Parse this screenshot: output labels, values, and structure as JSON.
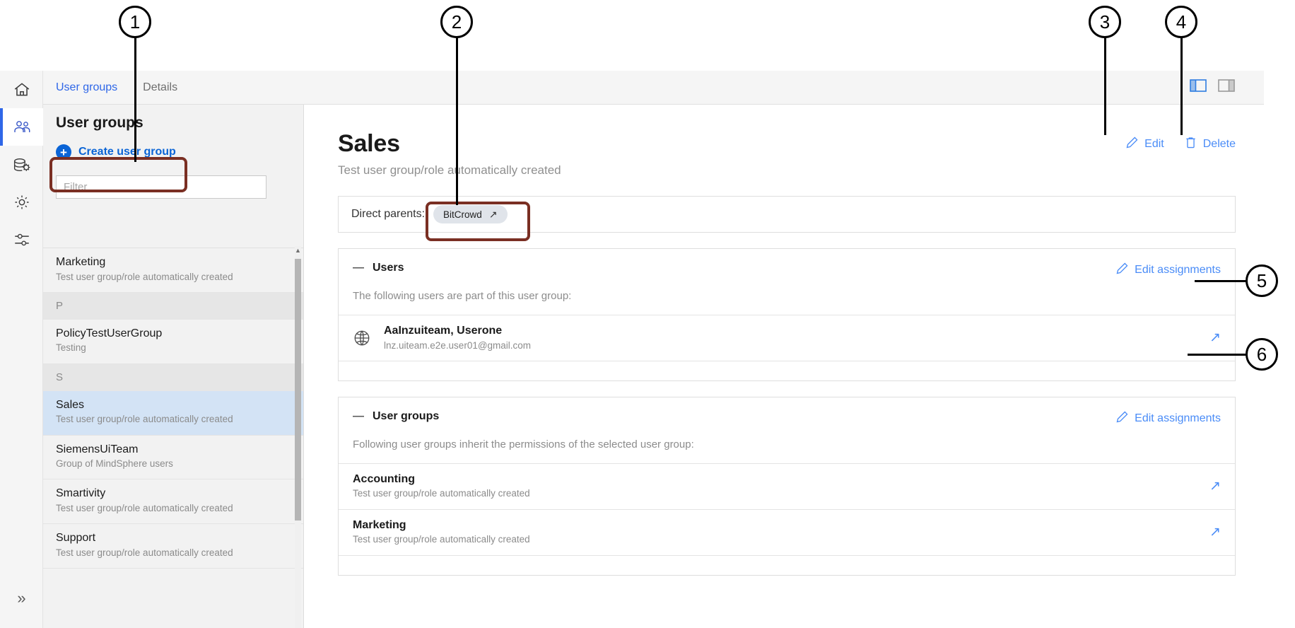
{
  "app": {
    "tabs": [
      {
        "label": "User groups",
        "active": true
      },
      {
        "label": "Details",
        "active": false
      }
    ],
    "panel_toggles": [
      {
        "name": "left-panel-toggle",
        "state": "active"
      },
      {
        "name": "right-panel-toggle",
        "state": "inactive"
      }
    ]
  },
  "rail": {
    "items": [
      {
        "icon": "home-icon",
        "name": "home",
        "active": false
      },
      {
        "icon": "users-icon",
        "name": "user-groups",
        "active": true
      },
      {
        "icon": "assets-icon",
        "name": "assets",
        "active": false
      },
      {
        "icon": "gear-icon",
        "name": "settings",
        "active": false
      },
      {
        "icon": "sliders-icon",
        "name": "preferences",
        "active": false
      }
    ],
    "expand_label": "»"
  },
  "sidebar": {
    "title": "User groups",
    "create_label": "Create user group",
    "create_icon": "plus-circle-icon",
    "filter_placeholder": "Filter",
    "filter_value": "",
    "list": [
      {
        "type": "item",
        "name": "Marketing",
        "desc": "Test user group/role automatically created",
        "selected": false
      },
      {
        "type": "header",
        "name": "P"
      },
      {
        "type": "item",
        "name": "PolicyTestUserGroup",
        "desc": "Testing",
        "selected": false
      },
      {
        "type": "header",
        "name": "S"
      },
      {
        "type": "item",
        "name": "Sales",
        "desc": "Test user group/role automatically created",
        "selected": true
      },
      {
        "type": "item",
        "name": "SiemensUiTeam",
        "desc": "Group of MindSphere users",
        "selected": false
      },
      {
        "type": "item",
        "name": "Smartivity",
        "desc": "Test user group/role automatically created",
        "selected": false
      },
      {
        "type": "item",
        "name": "Support",
        "desc": "Test user group/role automatically created",
        "selected": false
      }
    ]
  },
  "detail": {
    "title": "Sales",
    "subtitle": "Test user group/role automatically created",
    "edit_label": "Edit",
    "delete_label": "Delete",
    "parents_label": "Direct parents:",
    "parents_chips": [
      {
        "label": "BitCrowd",
        "arrow": "↗"
      }
    ],
    "users_section": {
      "title": "Users",
      "collapse": "—",
      "description": "The following users are part of this user group:",
      "edit_assignments_label": "Edit assignments",
      "rows": [
        {
          "icon": "globe-icon",
          "name": "AaInzuiteam, Userone",
          "sub": "lnz.uiteam.e2e.user01@gmail.com",
          "go": "↗"
        }
      ]
    },
    "usergroups_section": {
      "title": "User groups",
      "collapse": "—",
      "description": "Following user groups inherit the permissions of the selected user group:",
      "edit_assignments_label": "Edit assignments",
      "rows": [
        {
          "name": "Accounting",
          "sub": "Test user group/role automatically created",
          "go": "↗"
        },
        {
          "name": "Marketing",
          "sub": "Test user group/role automatically created",
          "go": "↗"
        }
      ]
    }
  },
  "callouts": [
    {
      "number": "1"
    },
    {
      "number": "2"
    },
    {
      "number": "3"
    },
    {
      "number": "4"
    },
    {
      "number": "5"
    },
    {
      "number": "6"
    }
  ],
  "colors": {
    "accent_blue": "#2f67e8",
    "link_blue": "#4a8cf7",
    "selected_row": "#d3e3f5",
    "highlight_box": "#7a2f23"
  }
}
